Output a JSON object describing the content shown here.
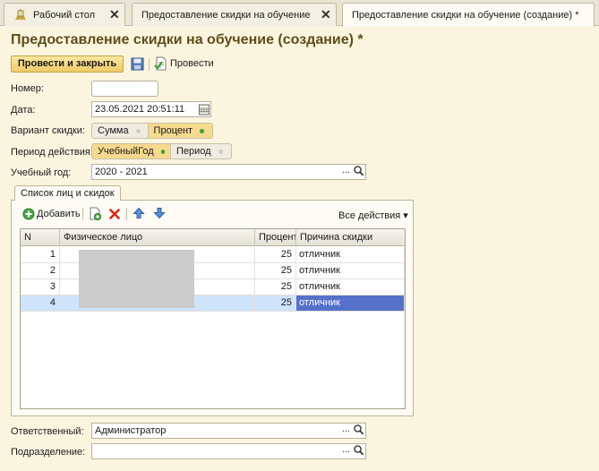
{
  "tabs": [
    {
      "label": "Рабочий стол",
      "close": "✕"
    },
    {
      "label": "Предоставление скидки на обучение",
      "close": "✕"
    },
    {
      "label": "Предоставление скидки на обучение (создание) *",
      "close": ""
    }
  ],
  "page": {
    "title": "Предоставление скидки на обучение (создание) *"
  },
  "toolbar": {
    "post_close_label": "Провести и закрыть",
    "post_label": "Провести"
  },
  "form": {
    "number": {
      "label": "Номер:",
      "value": ""
    },
    "date": {
      "label": "Дата:",
      "value": "23.05.2021 20:51:11"
    },
    "discount_variant": {
      "label": "Вариант скидки:",
      "options": [
        "Сумма",
        "Процент"
      ],
      "selected": "Процент"
    },
    "period": {
      "label": "Период действия:",
      "options": [
        "УчебныйГод",
        "Период"
      ],
      "selected": "УчебныйГод"
    },
    "school_year": {
      "label": "Учебный год:",
      "value": "2020 - 2021"
    },
    "responsible": {
      "label": "Ответственный:",
      "value": "Администратор"
    },
    "department": {
      "label": "Подразделение:",
      "value": ""
    },
    "ellipsis": "..."
  },
  "panel": {
    "tab_label": "Список лиц и скидок",
    "add_label": "Добавить",
    "all_actions_label": "Все действия ▾",
    "columns": [
      "N",
      "Физическое лицо",
      "Процент",
      "Причина скидки"
    ],
    "rows": [
      {
        "n": "1",
        "person": "",
        "percent": "25",
        "reason": "отличник"
      },
      {
        "n": "2",
        "person": "",
        "percent": "25",
        "reason": "отличник"
      },
      {
        "n": "3",
        "person": "",
        "percent": "25",
        "reason": "отличник"
      },
      {
        "n": "4",
        "person": "",
        "percent": "25",
        "reason": "отличник"
      }
    ],
    "selected_row": 4
  },
  "colors": {
    "title": "#5e4e1a",
    "primary_button": "#efcb69",
    "selection": "#cfe3fb",
    "selected_cell": "#5571c9"
  }
}
